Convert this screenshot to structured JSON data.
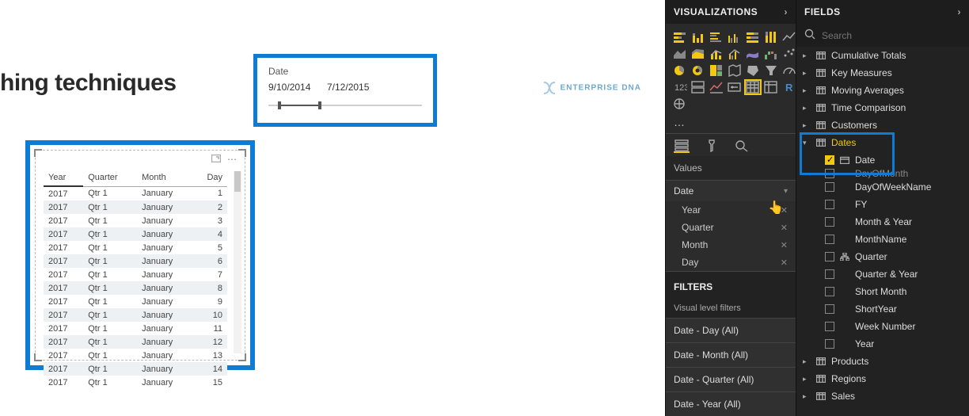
{
  "title": "hing techniques",
  "logo_text": "ENTERPRISE DNA",
  "slicer": {
    "label": "Date",
    "start": "9/10/2014",
    "end": "7/12/2015"
  },
  "table": {
    "headers": [
      "Year",
      "Quarter",
      "Month",
      "Day"
    ],
    "rows": [
      [
        "2017",
        "Qtr 1",
        "January",
        "1"
      ],
      [
        "2017",
        "Qtr 1",
        "January",
        "2"
      ],
      [
        "2017",
        "Qtr 1",
        "January",
        "3"
      ],
      [
        "2017",
        "Qtr 1",
        "January",
        "4"
      ],
      [
        "2017",
        "Qtr 1",
        "January",
        "5"
      ],
      [
        "2017",
        "Qtr 1",
        "January",
        "6"
      ],
      [
        "2017",
        "Qtr 1",
        "January",
        "7"
      ],
      [
        "2017",
        "Qtr 1",
        "January",
        "8"
      ],
      [
        "2017",
        "Qtr 1",
        "January",
        "9"
      ],
      [
        "2017",
        "Qtr 1",
        "January",
        "10"
      ],
      [
        "2017",
        "Qtr 1",
        "January",
        "11"
      ],
      [
        "2017",
        "Qtr 1",
        "January",
        "12"
      ],
      [
        "2017",
        "Qtr 1",
        "January",
        "13"
      ],
      [
        "2017",
        "Qtr 1",
        "January",
        "14"
      ],
      [
        "2017",
        "Qtr 1",
        "January",
        "15"
      ]
    ]
  },
  "vis": {
    "header": "VISUALIZATIONS",
    "values_label": "Values",
    "value_field": "Date",
    "value_children": [
      "Year",
      "Quarter",
      "Month",
      "Day"
    ],
    "filters_header": "FILTERS",
    "filters_sub": "Visual level filters",
    "filters": [
      "Date - Day (All)",
      "Date - Month (All)",
      "Date - Quarter (All)",
      "Date - Year (All)"
    ]
  },
  "fields": {
    "header": "FIELDS",
    "search_placeholder": "Search",
    "tables_top": [
      "Cumulative Totals",
      "Key Measures",
      "Moving Averages",
      "Time Comparison",
      "Customers"
    ],
    "dates_label": "Dates",
    "date_field": "Date",
    "date_sub_cut": "DayOfMonth",
    "dates_children": [
      "DayOfWeekName",
      "FY",
      "Month & Year",
      "MonthName",
      "Quarter",
      "Quarter & Year",
      "Short Month",
      "ShortYear",
      "Week Number",
      "Year"
    ],
    "tables_bottom": [
      "Products",
      "Regions",
      "Sales"
    ]
  }
}
